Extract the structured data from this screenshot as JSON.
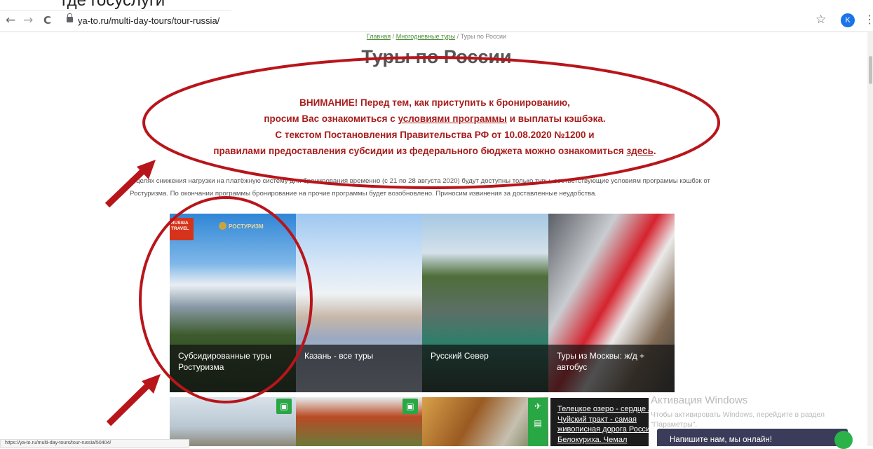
{
  "top_caption": "где госуслуги",
  "browser": {
    "back": "←",
    "forward": "→",
    "reload": "C",
    "url": "ya-to.ru/multi-day-tours/tour-russia/",
    "star": "☆",
    "avatar_letter": "K",
    "menu": "⋮"
  },
  "breadcrumb": {
    "home": "Главная",
    "sep1": " / ",
    "multi": "Многодневные туры",
    "sep2": " / ",
    "current": "Туры по России"
  },
  "page_title": "Туры по России",
  "warning": {
    "line1": "ВНИМАНИЕ! Перед тем, как приступить к бронированию,",
    "line2a": "просим Вас ознакомиться с ",
    "line2_link": "условиями программы",
    "line2b": " и выплаты кэшбэка.",
    "line3": "С текстом Постановления Правительства РФ от 10.08.2020 №1200 и",
    "line4a": "правилами предоставления субсидии из федерального бюджета можно ознакомиться ",
    "line4_link": "здесь",
    "line4b": "."
  },
  "notice": "В целях снижения нагрузки на платёжную систему для бронирования временно (с 21 по 28 августа 2020) будут доступны только туры, соответствующие условиям программы кэшбэк от Ростуризма. По окончании программы бронирование на прочие программы будет возобновлено. Приносим извинения за доставленные неудобства.",
  "tiles": [
    {
      "caption": "Субсидированные туры Ростуризма"
    },
    {
      "caption": "Казань - все туры"
    },
    {
      "caption": "Русский Север"
    },
    {
      "caption": "Туры из Москвы: ж/д + автобус"
    }
  ],
  "logos": {
    "russia_travel": "RUSSIA TRAVEL",
    "rostur": "РОСТУРИЗМ"
  },
  "side_card": {
    "text": "Телецкое озеро - сердце Алтая. Чуйский тракт - самая живописная дорога России. Белокуриха. Чемал"
  },
  "windows": {
    "title": "Активация Windows",
    "subtitle": "Чтобы активировать Windows, перейдите в раздел \"Параметры\"."
  },
  "chat": {
    "label": "Напишите нам, мы онлайн!"
  },
  "status_url": "https://ya-to.ru/multi-day-tours/tour-russia/50404/",
  "colors": {
    "accent_green": "#2aa745",
    "warning_red": "#a81c1c",
    "annotation_red": "#b8151b"
  }
}
